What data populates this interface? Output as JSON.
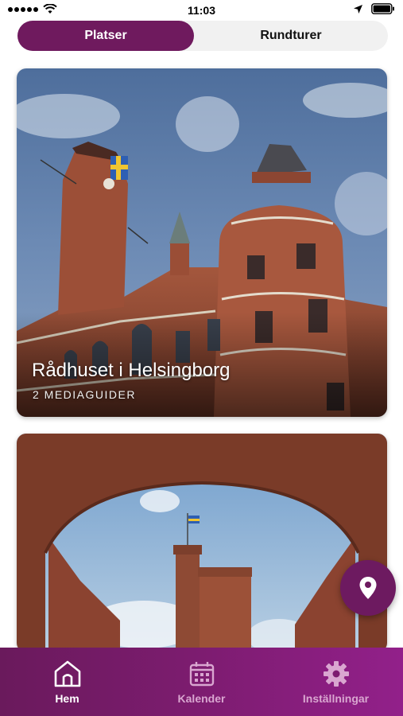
{
  "status_bar": {
    "time": "11:03"
  },
  "segment": {
    "active_label": "Platser",
    "inactive_label": "Rundturer"
  },
  "cards": [
    {
      "title": "Rådhuset i Helsingborg",
      "subtitle": "2 MEDIAGUIDER"
    },
    {
      "title": "",
      "subtitle": ""
    }
  ],
  "tabs": [
    {
      "label": "Hem",
      "icon": "home-icon",
      "active": true
    },
    {
      "label": "Kalender",
      "icon": "calendar-icon",
      "active": false
    },
    {
      "label": "Inställningar",
      "icon": "gear-icon",
      "active": false
    }
  ],
  "fab": {
    "icon": "map-pin-icon"
  },
  "colors": {
    "accent": "#6f1a5e",
    "tabbar_start": "#6a1a5c",
    "tabbar_end": "#92208a",
    "inactive_tab_text": "#d9a6d0"
  }
}
